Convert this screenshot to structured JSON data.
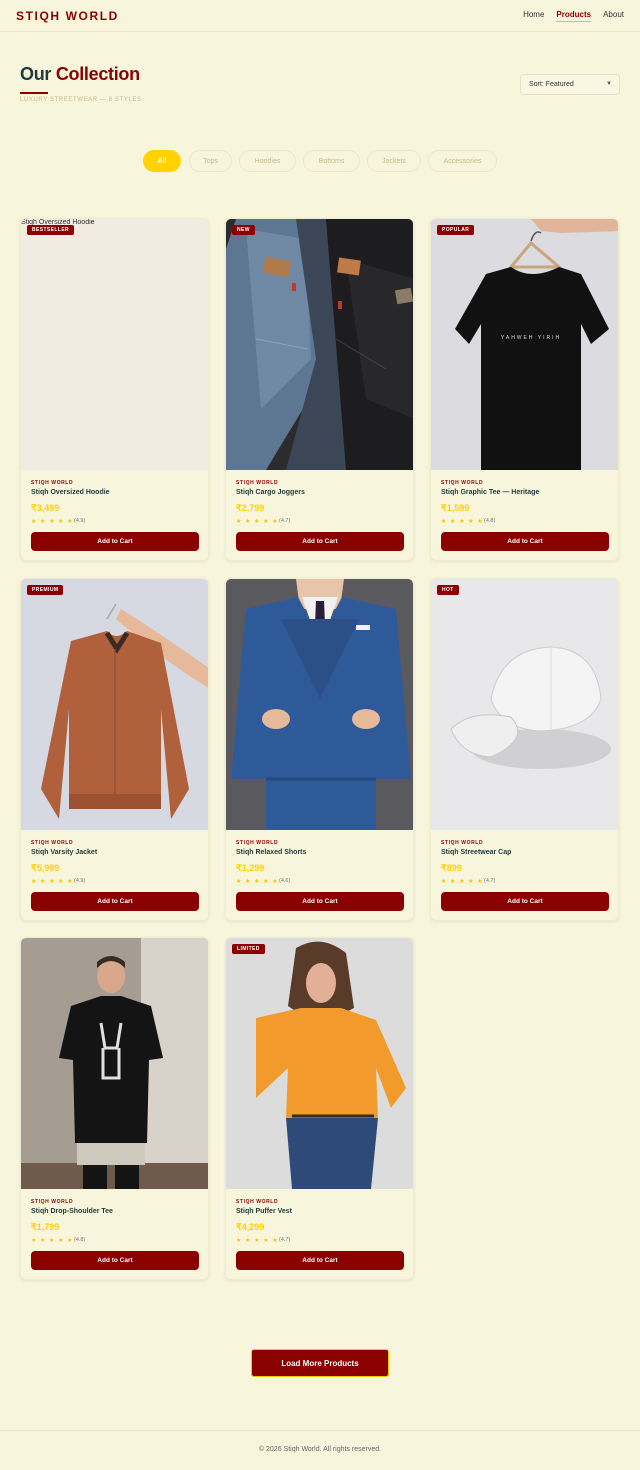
{
  "nav": {
    "brand": "STIQH WORLD",
    "links": [
      "Home",
      "Products",
      "About"
    ],
    "active": "Products"
  },
  "header": {
    "title_part1": "Our",
    "title_part2": "Collection",
    "subtitle": "LUXURY STREETWEAR — 8 STYLES",
    "sort_label": "Sort: Featured"
  },
  "filters": [
    "All",
    "Tops",
    "Hoodies",
    "Bottoms",
    "Jackets",
    "Accessories"
  ],
  "products": [
    {
      "badge": "BESTSELLER",
      "brand": "STIQH WORLD",
      "name": "Stiqh Oversized Hoodie",
      "price": "₹3,499",
      "stars": "★ ★ ★ ★ ★",
      "rating": "(4.9)",
      "cart": "Add to Cart",
      "img_alt": "Stiqh Oversized Hoodie"
    },
    {
      "badge": "NEW",
      "brand": "STIQH WORLD",
      "name": "Stiqh Cargo Joggers",
      "price": "₹2,799",
      "stars": "★ ★ ★ ★ ★",
      "rating": "(4.7)",
      "cart": "Add to Cart"
    },
    {
      "badge": "POPULAR",
      "brand": "STIQH WORLD",
      "name": "Stiqh Graphic Tee — Heritage",
      "price": "₹1,599",
      "stars": "★ ★ ★ ★ ★",
      "rating": "(4.8)",
      "cart": "Add to Cart",
      "print": "YAHWEH YIRIH"
    },
    {
      "badge": "PREMIUM",
      "brand": "STIQH WORLD",
      "name": "Stiqh Varsity Jacket",
      "price": "₹5,999",
      "stars": "★ ★ ★ ★ ★",
      "rating": "(4.9)",
      "cart": "Add to Cart"
    },
    {
      "badge": "",
      "brand": "STIQH WORLD",
      "name": "Stiqh Relaxed Shorts",
      "price": "₹1,299",
      "stars": "★ ★ ★ ★ ★",
      "rating": "(4.6)",
      "cart": "Add to Cart"
    },
    {
      "badge": "HOT",
      "brand": "STIQH WORLD",
      "name": "Stiqh Streetwear Cap",
      "price": "₹899",
      "stars": "★ ★ ★ ★ ★",
      "rating": "(4.7)",
      "cart": "Add to Cart"
    },
    {
      "badge": "",
      "brand": "STIQH WORLD",
      "name": "Stiqh Drop-Shoulder Tee",
      "price": "₹1,799",
      "stars": "★ ★ ★ ★ ★",
      "rating": "(4.8)",
      "cart": "Add to Cart"
    },
    {
      "badge": "LIMITED",
      "brand": "STIQH WORLD",
      "name": "Stiqh Puffer Vest",
      "price": "₹4,299",
      "stars": "★ ★ ★ ★ ★",
      "rating": "(4.7)",
      "cart": "Add to Cart"
    }
  ],
  "load_more": "Load More Products",
  "footer": "© 2026 Stiqh World. All rights reserved.",
  "colors": {
    "brand": "#8b0000",
    "accent": "#ffd200",
    "background": "#f7f5dc",
    "heading": "#1f3a3a"
  }
}
